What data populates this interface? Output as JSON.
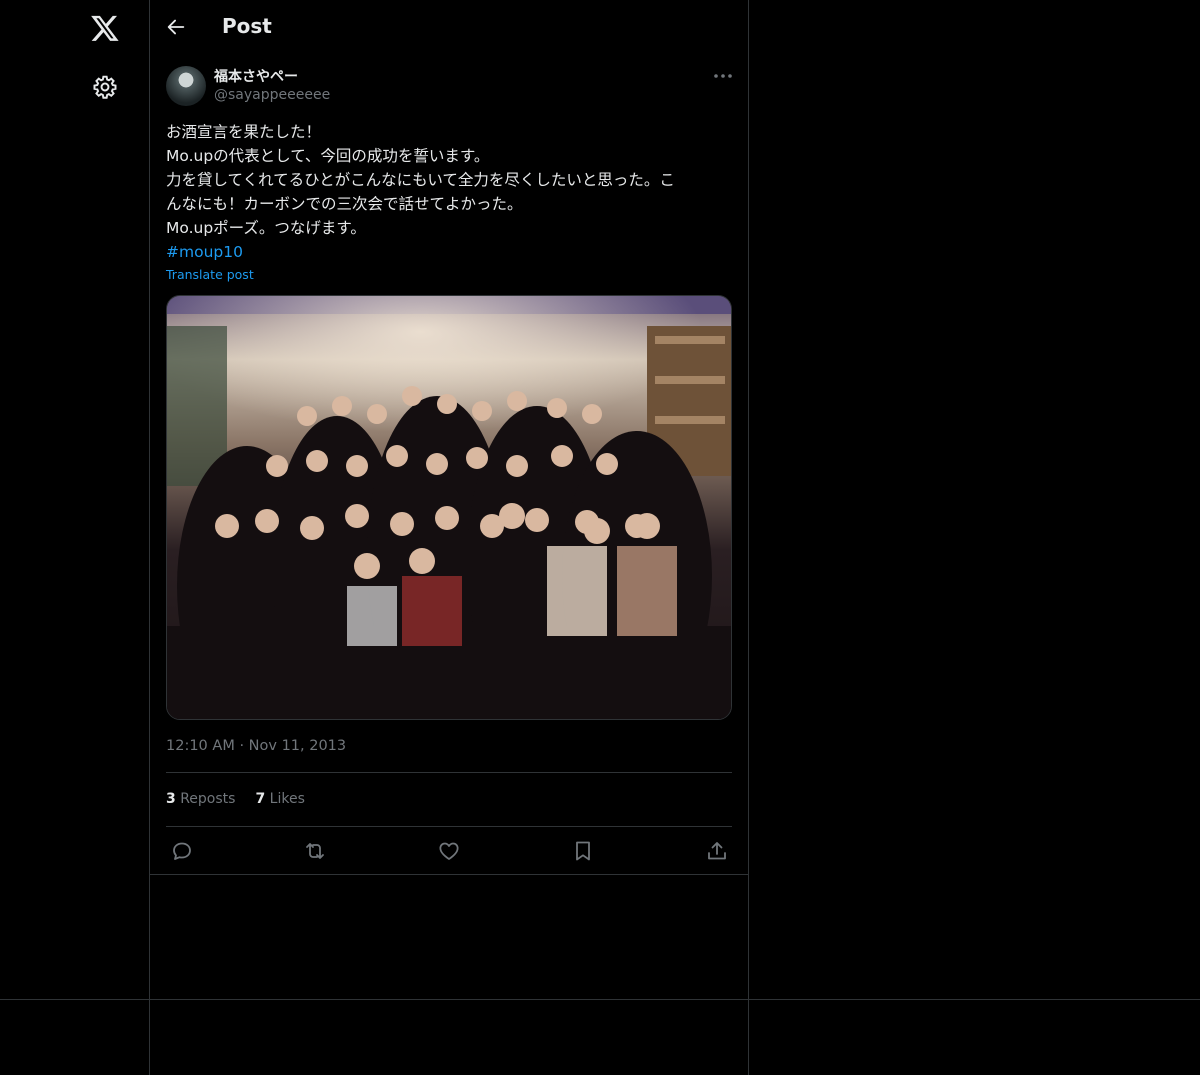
{
  "header": {
    "title": "Post"
  },
  "post": {
    "author": {
      "display_name": "福本さやペー",
      "handle": "@sayappeeeeee"
    },
    "text_lines": [
      "お酒宣言を果たした！",
      "Mo.upの代表として、今回の成功を誓います。",
      "力を貸してくれてるひとがこんなにもいて全力を尽くしたいと思った。こ",
      "んなにも！カーボンでの三次会で話せてよかった。",
      "Mo.upポーズ。つなげます。"
    ],
    "hashtag": "#moup10",
    "translate_label": "Translate post",
    "time": "12:10 AM",
    "dot": "·",
    "date": "Nov 11, 2013",
    "reposts_count": "3",
    "reposts_label": "Reposts",
    "likes_count": "7",
    "likes_label": "Likes"
  },
  "icons": {
    "logo": "x-logo-icon",
    "settings": "gear-icon",
    "back": "arrow-left-icon",
    "more": "more-horizontal-icon",
    "reply": "reply-icon",
    "repost": "repost-icon",
    "like": "heart-icon",
    "bookmark": "bookmark-icon",
    "share": "share-icon"
  },
  "colors": {
    "background": "#000000",
    "text": "#e7e9ea",
    "muted": "#71767b",
    "accent": "#1d9bf0",
    "border": "#2f3336"
  }
}
